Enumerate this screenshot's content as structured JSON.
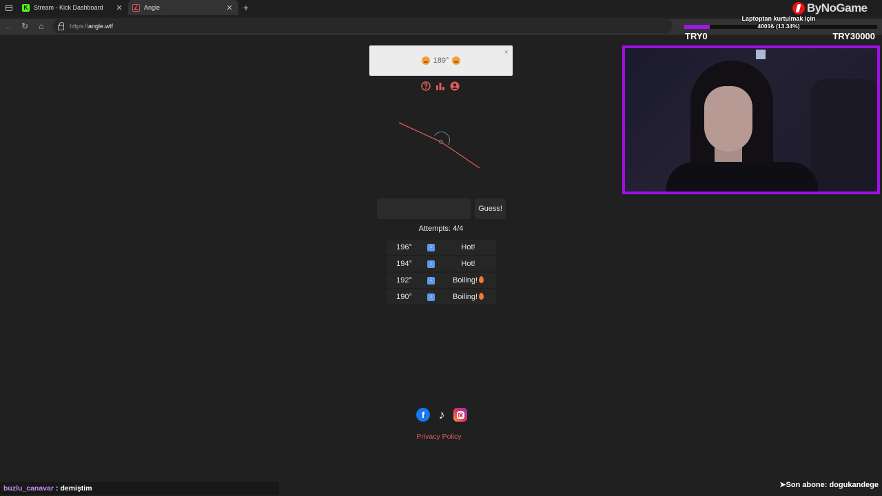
{
  "browser": {
    "tabs": [
      {
        "title": "Stream - Kick Dashboard",
        "favicon": "kick-logo",
        "active": false
      },
      {
        "title": "Angle",
        "favicon": "angle-logo",
        "active": true
      }
    ],
    "url_scheme": "https://",
    "url_host": "angle.wtf"
  },
  "overlay": {
    "brand": "ByNoGame",
    "goal_title": "Laptoptan kurtulmak için",
    "goal_value": "4001₺ (13.34%)",
    "goal_progress_percent": 13.34,
    "goal_left_label": "TRY0",
    "goal_right_label": "TRY30000",
    "chat_user": "buzlu_canavar",
    "chat_sep": ":",
    "chat_message": "demiştim",
    "subscriber_ticker": "➤Son abone: dogukandege"
  },
  "game": {
    "toast_text": "189°",
    "toast_close": "×",
    "target_angle_deg": 189,
    "guess_placeholder": "",
    "guess_button": "Guess!",
    "attempts_label": "Attempts: 4/4",
    "attempts": [
      {
        "guess": "196°",
        "direction": "down",
        "result": "Hot!",
        "flame": false
      },
      {
        "guess": "194°",
        "direction": "down",
        "result": "Hot!",
        "flame": false
      },
      {
        "guess": "192°",
        "direction": "down",
        "result": "Boiling!",
        "flame": true
      },
      {
        "guess": "190°",
        "direction": "down",
        "result": "Boiling!",
        "flame": true
      }
    ],
    "privacy_link": "Privacy Policy"
  },
  "colors": {
    "accent_red": "#e15a55",
    "overlay_purple": "#9c10e8",
    "arrow_blue": "#5a9be8"
  }
}
